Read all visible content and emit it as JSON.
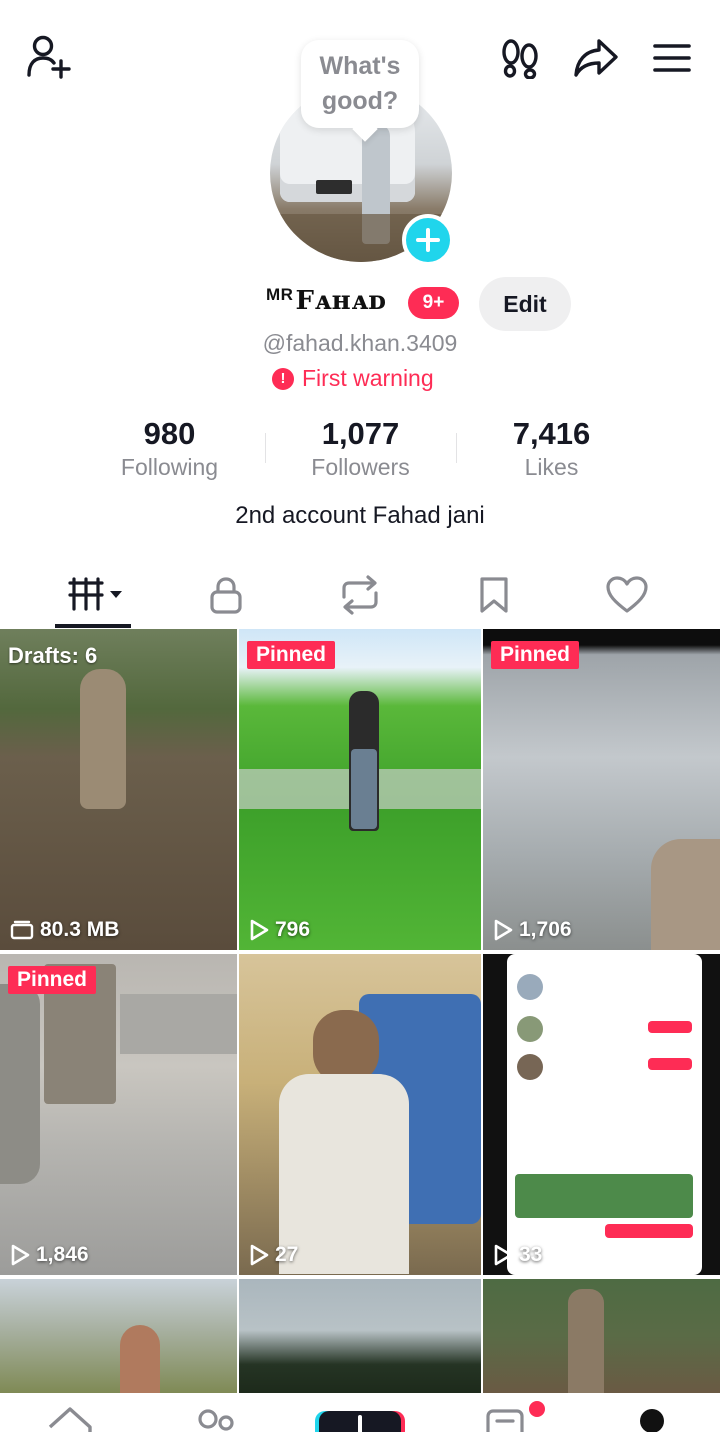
{
  "bubble": {
    "line1": "What's",
    "line2": "good?"
  },
  "profile": {
    "name_prefix": "MR",
    "name": "Fᴀʜᴀᴅ",
    "notification_badge": "9+",
    "edit_label": "Edit",
    "handle": "@fahad.khan.3409",
    "warning_icon": "!",
    "warning": "First warning",
    "bio": "2nd account Fahad jani"
  },
  "stats": [
    {
      "value": "980",
      "label": "Following"
    },
    {
      "value": "1,077",
      "label": "Followers"
    },
    {
      "value": "7,416",
      "label": "Likes"
    }
  ],
  "grid": {
    "drafts_label": "Drafts: 6",
    "drafts_size": "80.3 MB",
    "pinned_label": "Pinned",
    "views": [
      "796",
      "1,706",
      "1,846",
      "27",
      "33"
    ]
  },
  "colors": {
    "accent": "#fe2c55",
    "avatar_add": "#20d5ec"
  }
}
